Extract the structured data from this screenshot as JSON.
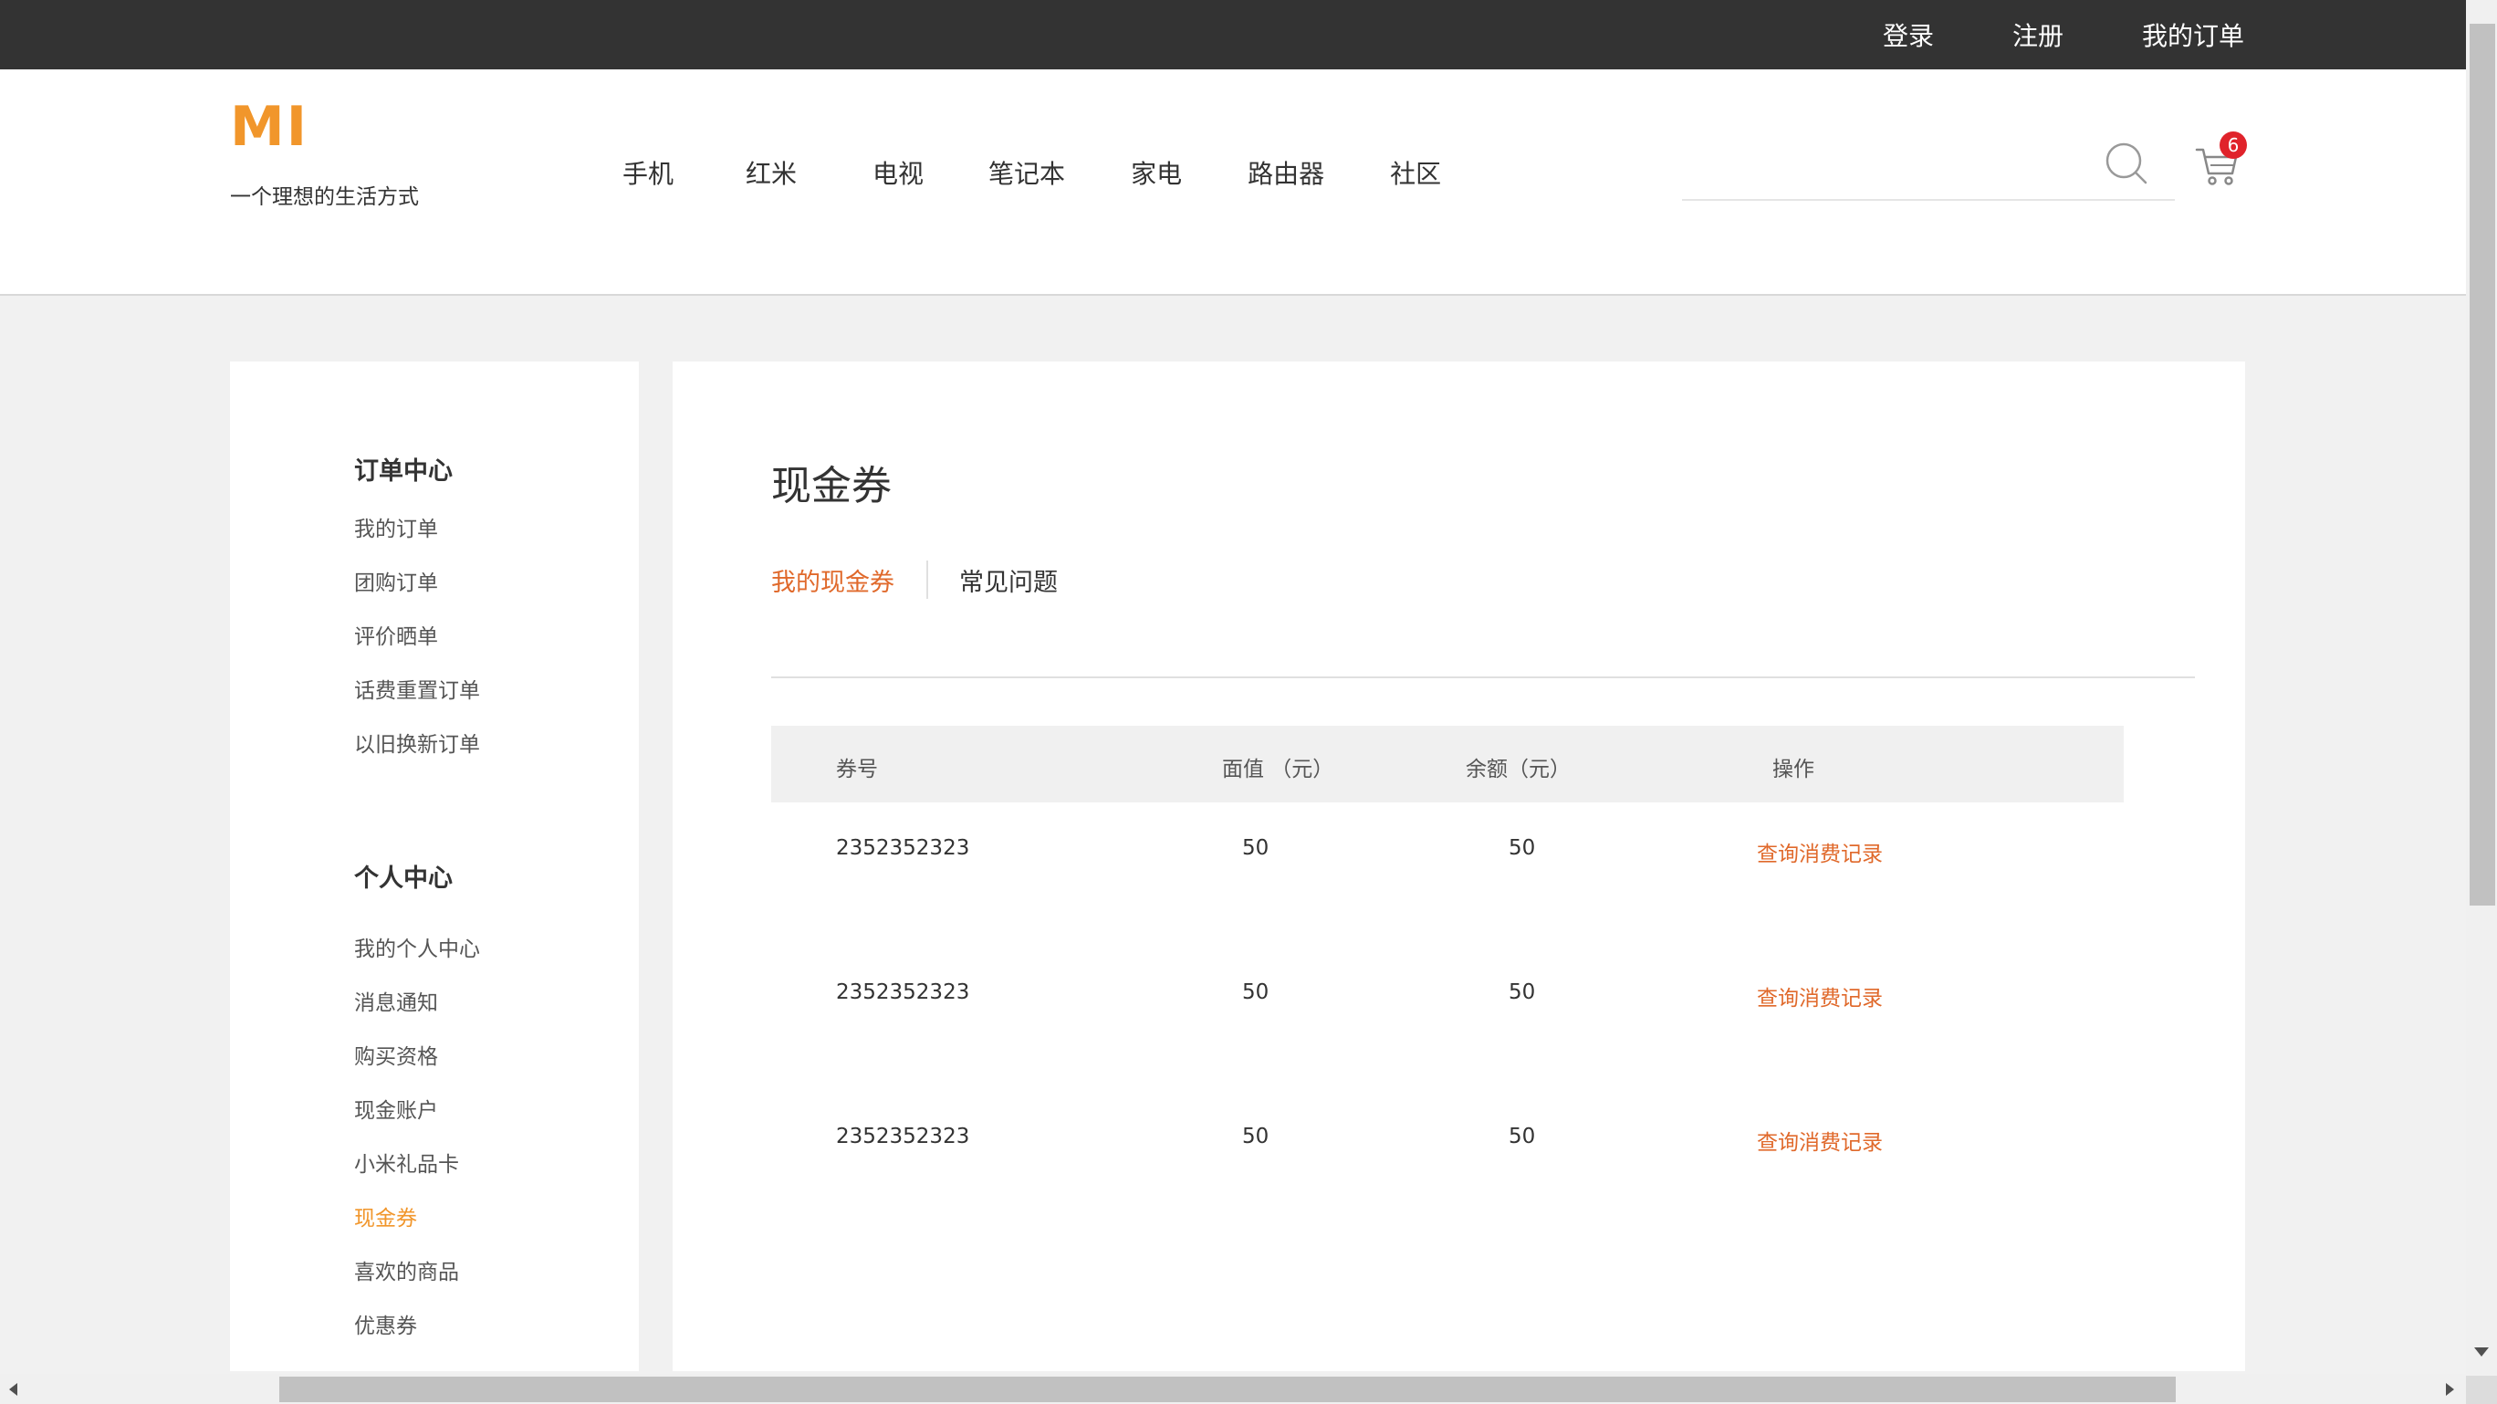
{
  "topbar": {
    "login": "登录",
    "register": "注册",
    "my_orders": "我的订单"
  },
  "header": {
    "logo": "MI",
    "slogan": "一个理想的生活方式",
    "nav": [
      "手机",
      "红米",
      "电视",
      "笔记本",
      "家电",
      "路由器",
      "社区"
    ],
    "search_placeholder": "",
    "cart_count": "6"
  },
  "sidebar": {
    "order_center": {
      "title": "订单中心",
      "items": [
        "我的订单",
        "团购订单",
        "评价晒单",
        "话费重置订单",
        "以旧换新订单"
      ]
    },
    "personal_center": {
      "title": "个人中心",
      "items": [
        "我的个人中心",
        "消息通知",
        "购买资格",
        "现金账户",
        "小米礼品卡",
        "现金券",
        "喜欢的商品",
        "优惠券"
      ],
      "active": "现金券"
    }
  },
  "main": {
    "title": "现金券",
    "tabs": [
      "我的现金券",
      "常见问题"
    ],
    "table": {
      "headers": [
        "券号",
        "面值 （元）",
        "余额（元）",
        "操作"
      ],
      "rows": [
        {
          "code": "2352352323",
          "face": "50",
          "balance": "50",
          "action": "查询消费记录"
        },
        {
          "code": "2352352323",
          "face": "50",
          "balance": "50",
          "action": "查询消费记录"
        },
        {
          "code": "2352352323",
          "face": "50",
          "balance": "50",
          "action": "查询消费记录"
        }
      ]
    }
  },
  "colors": {
    "accent": "#f1962b",
    "link": "#e0692b",
    "topbar": "#333333",
    "badge": "#e0232b"
  }
}
